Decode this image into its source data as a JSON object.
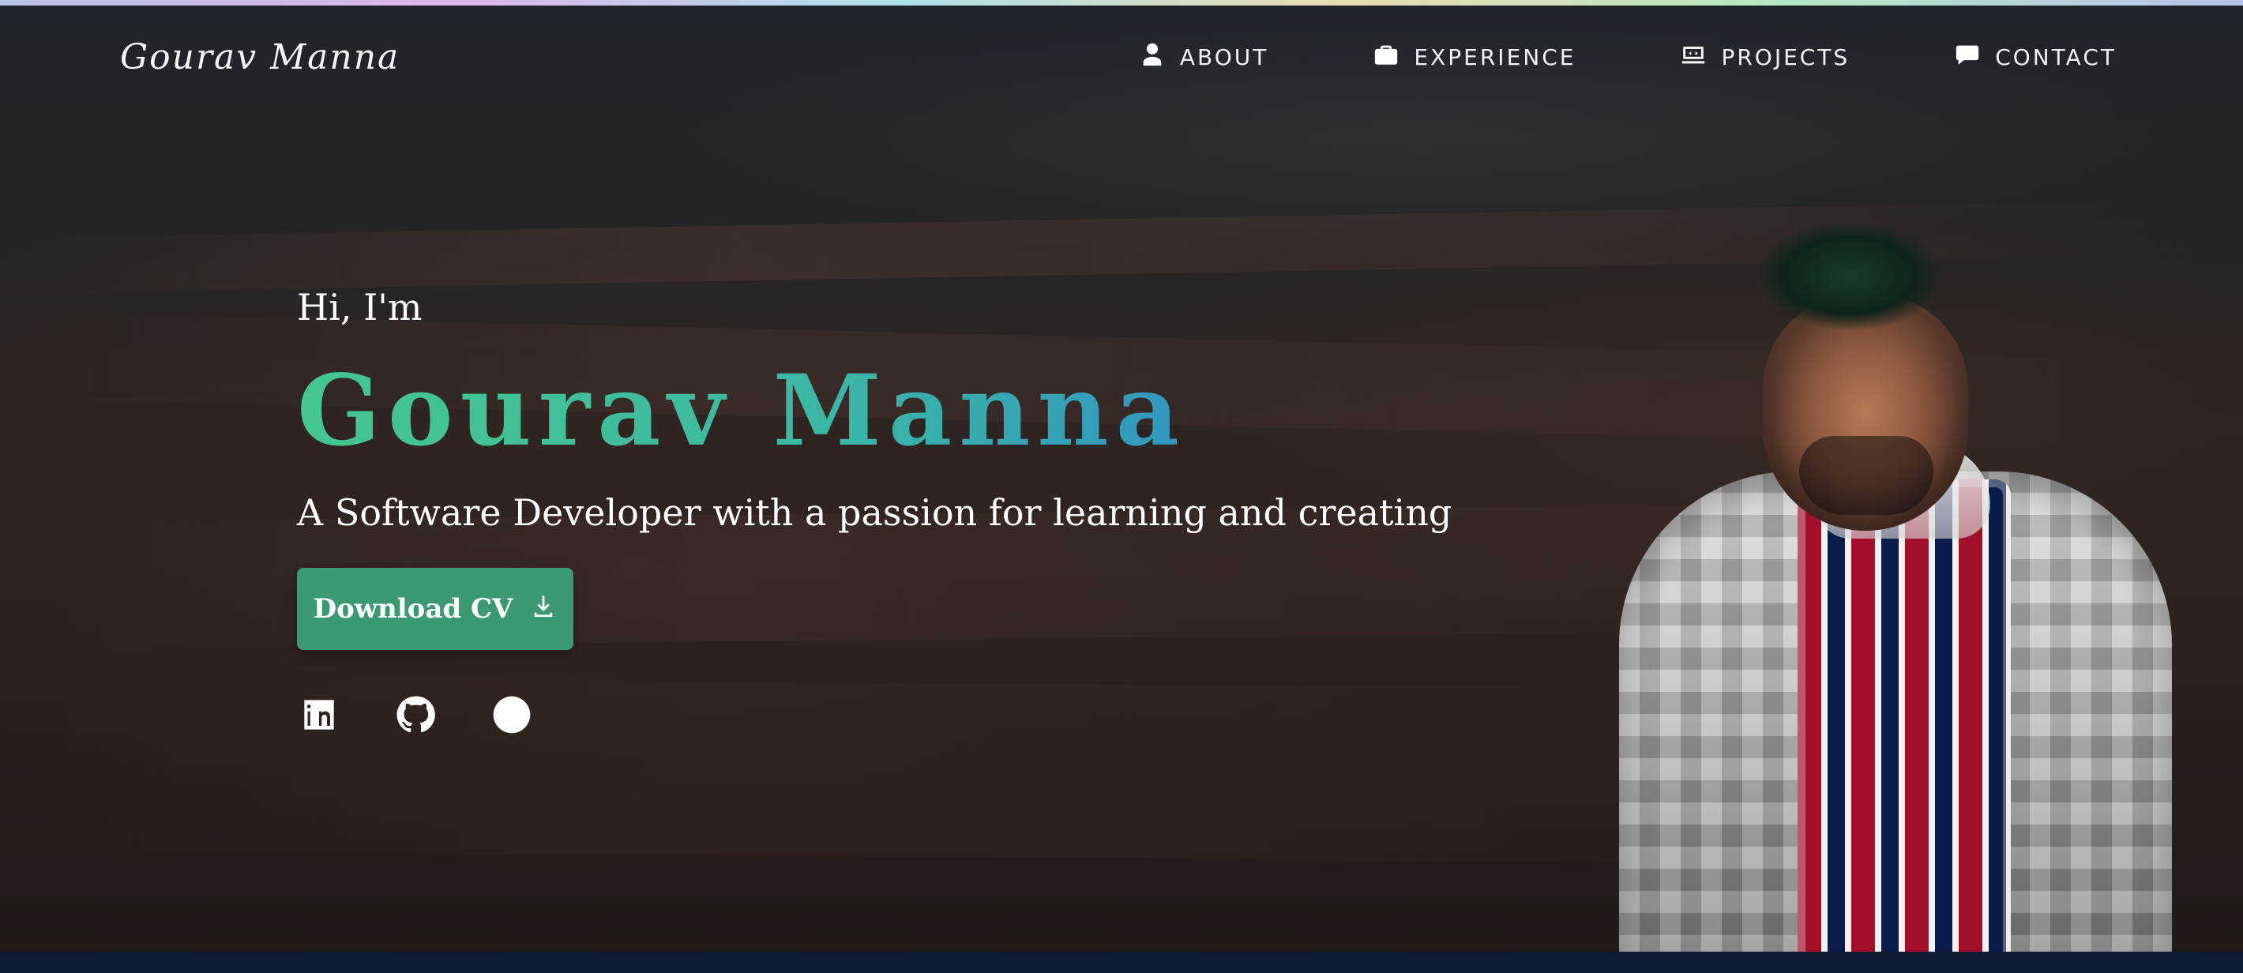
{
  "brand": {
    "name": "Gourav Manna"
  },
  "nav": {
    "items": [
      {
        "label": "ABOUT",
        "icon": "user-icon"
      },
      {
        "label": "EXPERIENCE",
        "icon": "briefcase-icon"
      },
      {
        "label": "PROJECTS",
        "icon": "laptop-icon"
      },
      {
        "label": "CONTACT",
        "icon": "message-icon"
      }
    ]
  },
  "hero": {
    "greeting": "Hi, I'm",
    "name": "Gourav Manna",
    "tagline": "A Software Developer with a passion for learning and creating",
    "cta_label": "Download CV"
  },
  "socials": [
    {
      "name": "LinkedIn",
      "icon": "linkedin-icon"
    },
    {
      "name": "GitHub",
      "icon": "github-icon"
    },
    {
      "name": "Facebook",
      "icon": "facebook-icon"
    }
  ],
  "colors": {
    "cta_bg": "#3c9a72",
    "name_gradient_start": "#45c78d",
    "name_gradient_end": "#2b7fd3"
  }
}
